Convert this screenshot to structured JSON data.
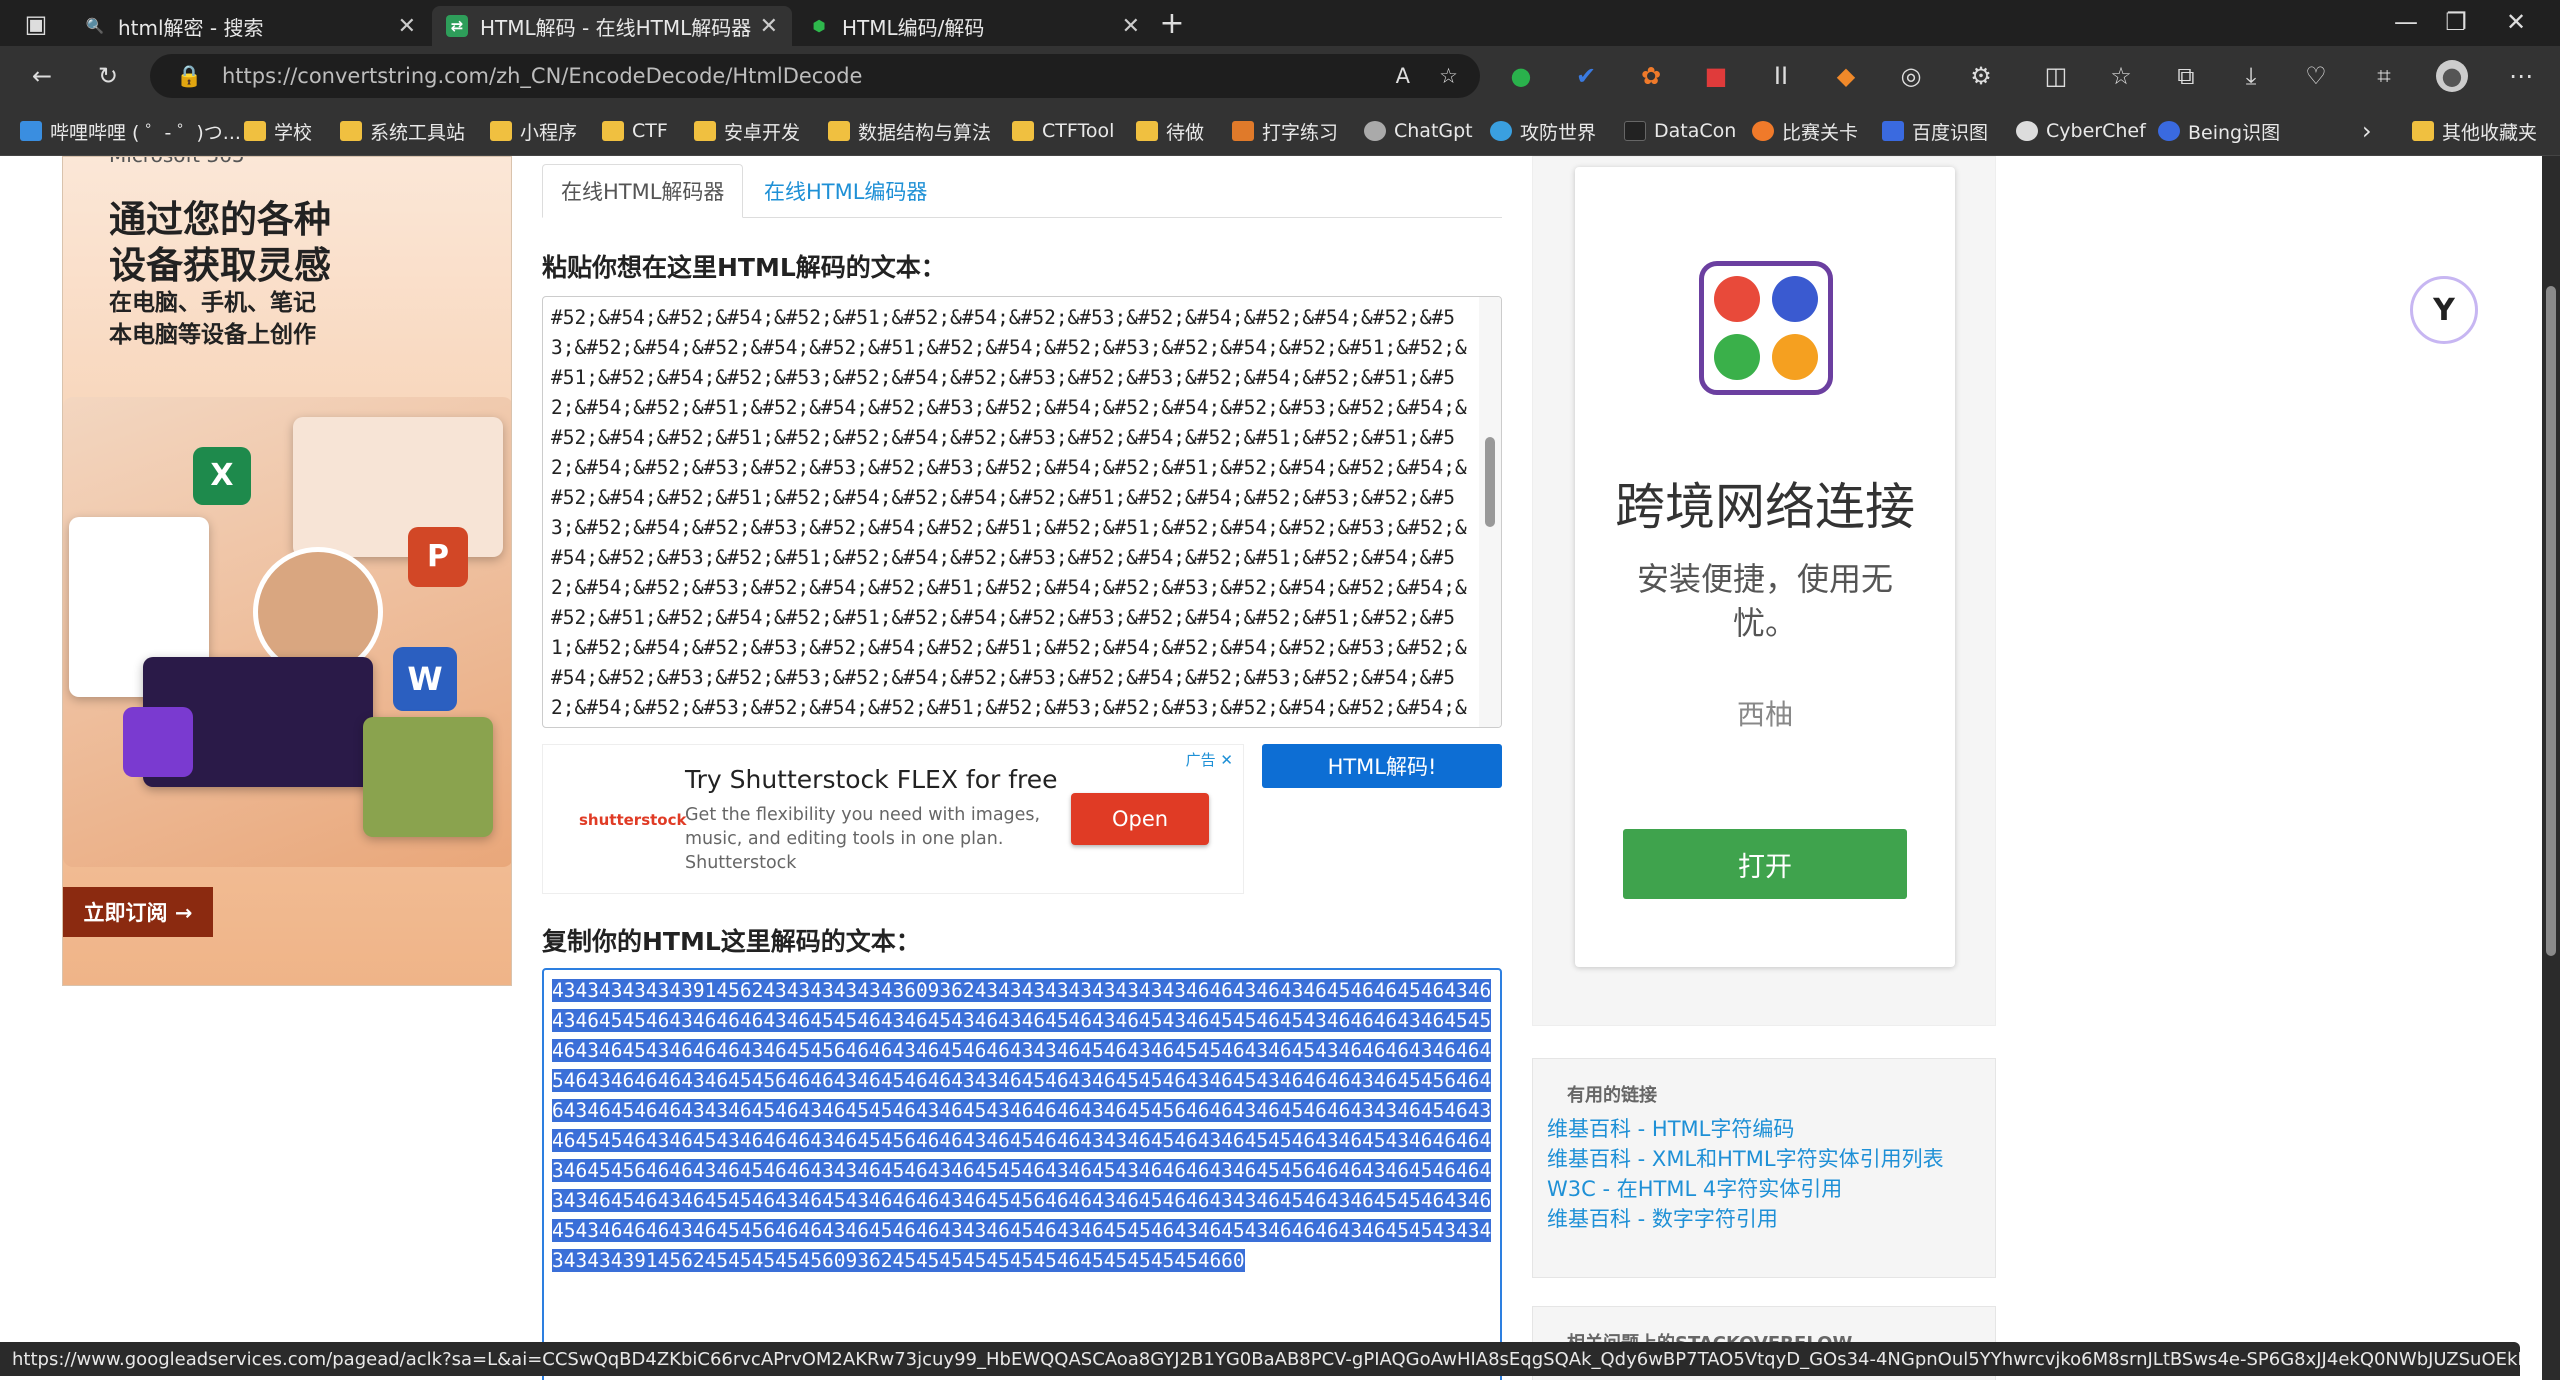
{
  "browser": {
    "tabs": [
      {
        "title": "html解密 - 搜索"
      },
      {
        "title": "HTML解码 - 在线HTML解码器"
      },
      {
        "title": "HTML编码/解码"
      }
    ],
    "url": "https://convertstring.com/zh_CN/EncodeDecode/HtmlDecode",
    "bookmarks": [
      "哔哩哔哩 ( ゜- ゜)つ...",
      "学校",
      "系统工具站",
      "小程序",
      "CTF",
      "安卓开发",
      "数据结构与算法",
      "CTFTool",
      "待做",
      "打字练习",
      "ChatGpt",
      "攻防世界",
      "DataCon",
      "比赛关卡",
      "百度识图",
      "CyberChef",
      "Being识图",
      "其他收藏夹"
    ],
    "status_url": "https://www.googleadservices.com/pagead/aclk?sa=L&ai=CCSwQqBD4ZKbiC66rvcAPrvOM2AKRw73jcuy99_HbEWQQASCAoa8GYJ2B1YG0BaAB8PCV-gPIAQGoAwHIA8sEqgSQAk_Qdy6wBP7TAO5VtqyD_GOs34-4NGpnOul5YYhwrcvjko6M8srnJLtBSws4e-SP6G8xJJ4ekQ0NWbJUZSuOEkRSpwNz1a0dRDmYy7IsIoA5n..."
  },
  "left_ad": {
    "brand": "Microsoft 365",
    "headline_1": "通过您的各种",
    "headline_2": "设备获取灵感",
    "sub_1": "在电脑、手机、笔记",
    "sub_2": "本电脑等设备上创作",
    "cta": "立即订阅 →"
  },
  "main": {
    "tab_decode": "在线HTML解码器",
    "tab_encode": "在线HTML编码器",
    "input_heading": "粘贴你想在这里HTML解码的文本：",
    "input_value": "#52;&#54;&#52;&#54;&#52;&#51;&#52;&#54;&#52;&#53;&#52;&#54;&#52;&#54;&#52;&#53;&#52;&#54;&#52;&#54;&#52;&#51;&#52;&#54;&#52;&#53;&#52;&#54;&#52;&#51;&#52;&#51;&#52;&#54;&#52;&#53;&#52;&#54;&#52;&#53;&#52;&#53;&#52;&#54;&#52;&#51;&#52;&#54;&#52;&#51;&#52;&#54;&#52;&#53;&#52;&#54;&#52;&#54;&#52;&#53;&#52;&#54;&#52;&#54;&#52;&#51;&#52;&#52;&#54;&#52;&#53;&#52;&#54;&#52;&#51;&#52;&#51;&#52;&#54;&#52;&#53;&#52;&#53;&#52;&#53;&#52;&#54;&#52;&#51;&#52;&#54;&#52;&#54;&#52;&#54;&#52;&#51;&#52;&#54;&#52;&#54;&#52;&#51;&#52;&#54;&#52;&#53;&#52;&#53;&#52;&#54;&#52;&#53;&#52;&#54;&#52;&#51;&#52;&#51;&#52;&#54;&#52;&#53;&#52;&#54;&#52;&#53;&#52;&#51;&#52;&#54;&#52;&#53;&#52;&#54;&#52;&#51;&#52;&#54;&#52;&#54;&#52;&#53;&#52;&#54;&#52;&#51;&#52;&#54;&#52;&#53;&#52;&#54;&#52;&#54;&#52;&#51;&#52;&#54;&#52;&#51;&#52;&#54;&#52;&#53;&#52;&#54;&#52;&#51;&#52;&#51;&#52;&#54;&#52;&#53;&#52;&#54;&#52;&#51;&#52;&#54;&#52;&#54;&#52;&#53;&#52;&#54;&#52;&#53;&#52;&#53;&#52;&#54;&#52;&#53;&#52;&#54;&#52;&#53;&#52;&#54;&#52;&#54;&#52;&#53;&#52;&#54;&#52;&#51;&#52;&#53;&#52;&#53;&#52;&#54;&#52;&#54;&#52;&#53;&#52;&#54;&#52;&#51;&#52;&#54;&#52;&#53;&#52;&#54;&#52;&#53;&#52;&#51;&#52;&#54;&#52;&#54;&#52;&#53;&#52;&#51;&#52;&#54;&#52;&#53;&#52;&#54;&#52;&#54;&#52;&#54;&#52;&#54;&#52;&#51;&#52;&#54;&#52;&#53;&#52;&#54;&#52;&#54;&#52;&#53;&#52;&#54;&#52;&#51;&#52;&#54;&#52;&#51;&#52;&#54;&#52;&#53;&#52;&#53;&#52;&#53;&#52;&#54;&#52;&#53;&#52;&#54;&#52;&#51;&#52;&#51;&#52;&#54;&#52;&#53;&#52;&#54;&#52;&#53;&#52;&#53;&#52;&#54;&#52;&#54;&#52;&#53;&#52;&#54;&#52;&#54;&#52;&#54;&#52;&#54;&#52;&#51;&#52;&#54;&#52;&#53;&#52;&#54;&#52;&#53;&#52;&#54;&#52;&#54;&#52;&#53;&#52;&#53;&#52;&#54;&#52;&#53;&#52;&#54;&#52;&#53;&#52;&#54;&#52;&#51;&#52;&#53;&#52;&#51;&#52;&#54;&#52;&#54;&#52;&#53;&#52;&#53;&#52;&#53;&#52;&#54;&#52;&#54;&#52;&#51;&#52;&#53;&#52;&#53;&#52;&#54;&#52;&#53;&#52;&#54;&#52;&#53;&#52;&#51;&#52;&#54;&#52;&#53;&#52;&#54;&#52;&#51;&#52;&#54;&#52;&#53;&#52;&#54;&#52;&#53;&#52;&#53;&#52;&#54;&#52;&#54;&#52;&#54;&#52;&#51;&#52;&#53;&#52;&#53;&#52;&#54;&#52;&#54;&#52;&#51;&#52;&#53;&#52;&#53;&#52;&#53;&#52;",
    "ad_title": "Try Shutterstock FLEX for free",
    "ad_desc": "Get the flexibility you need with images, music, and editing tools in one plan.",
    "ad_brand": "Shutterstock",
    "ad_logo": "shutterstock",
    "ad_open": "Open",
    "ad_tag": "广告 ✕",
    "decode_button": "HTML解码!",
    "output_heading": "复制你的HTML这里解码的文本：",
    "output_value": "43434343434391456243434343434360936243434343434343434346464346434645464645464346434645454643464646434645454643464543464346454643464543464545464543464646434645454643464543464646434645456464643464546464343464546434645454643464543464646434646454643464646434645456464643464546464343464546434645454643464543464646434645456464643464546464343464546434645454643464543464646434645456464643464546464343464546434645454643464543464646434645456464643464546464343464546434645454643464543464646434645456464643464546464343464546434645454643464543464646434645456464643464546464343464546434645454643464543464646434645456464643464546464343464546434645454643464543464646434645456464643464546464343464546434645454643464543464646434645454343434343439145624545454545609362454545454545454645454545454660"
  },
  "right_ad": {
    "title": "跨境网络连接",
    "subtitle": "安装便捷，使用无忧。",
    "brand": "西柚",
    "button": "打开"
  },
  "useful_links": {
    "title": "有用的链接",
    "items": [
      "维基百科 - HTML字符编码",
      "维基百科 - XML和HTML字符实体引用列表",
      "W3C - 在HTML 4字符实体引用",
      "维基百科 - 数字字符引用"
    ]
  },
  "stackoverflow": {
    "title": "相关问题上的STACKOVERFLOW"
  }
}
